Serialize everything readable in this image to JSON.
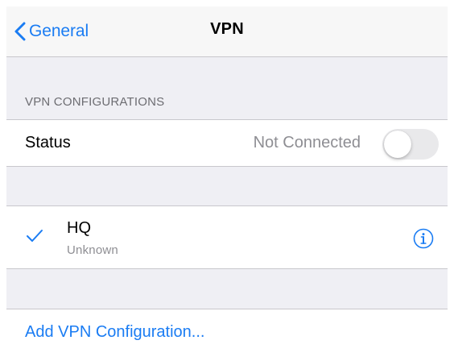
{
  "nav": {
    "back_label": "General",
    "title": "VPN"
  },
  "configurations": {
    "header": "VPN CONFIGURATIONS",
    "status_label": "Status",
    "status_value": "Not Connected",
    "toggle_on": false
  },
  "vpn": {
    "name": "HQ",
    "status": "Unknown",
    "selected": true
  },
  "add": {
    "label": "Add VPN Configuration..."
  },
  "colors": {
    "accent": "#1a7cf3",
    "background": "#efeff4",
    "secondary_text": "#8e8e93",
    "toggle_off": "#e9e9eb"
  },
  "icons": {
    "back": "chevron-left-icon",
    "check": "checkmark-icon",
    "info": "info-icon"
  }
}
